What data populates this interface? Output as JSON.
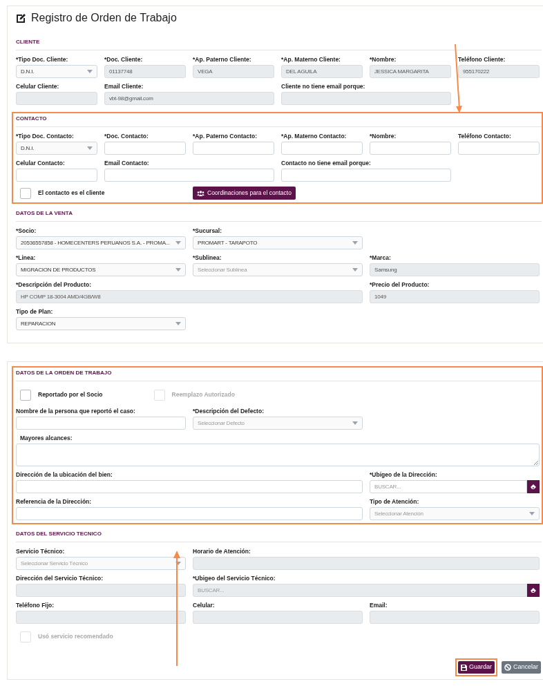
{
  "cards": [
    {
      "title": "Registro de Orden de Trabajo",
      "sections": [
        {
          "title": "CLIENTE",
          "highlighted": false,
          "rows": [
            [
              {
                "kind": "select",
                "label": "*Tipo Doc. Cliente:",
                "value": "D.N.I.",
                "disabled": false
              },
              {
                "kind": "input",
                "label": "*Doc. Cliente:",
                "value": "01137748",
                "disabled": true
              },
              {
                "kind": "input",
                "label": "*Ap. Paterno Cliente:",
                "value": "VEGA",
                "disabled": true
              },
              {
                "kind": "input",
                "label": "*Ap. Materno Cliente:",
                "value": "DEL AGUILA",
                "disabled": true
              },
              {
                "kind": "input",
                "label": "*Nombre:",
                "value": "JESSICA MARGARITA",
                "disabled": true
              },
              {
                "kind": "input",
                "label": "Teléfono Cliente:",
                "value": "955170222",
                "disabled": true
              }
            ],
            [
              {
                "kind": "input",
                "label": "Celular Cliente:",
                "disabled": true
              },
              {
                "kind": "input",
                "label": "Email Cliente:",
                "value": "vbt-98@gmail.com",
                "disabled": true
              },
              "",
              {
                "kind": "input",
                "label": "Cliente no tiene email porque:",
                "disabled": true
              }
            ]
          ]
        },
        {
          "title": "CONTACTO",
          "highlighted": true,
          "rows": [
            [
              {
                "kind": "select",
                "label": "*Tipo Doc. Contacto:",
                "value": "D.N.I.",
                "disabled": false
              },
              {
                "kind": "input",
                "label": "*Doc. Contacto:",
                "disabled": false
              },
              {
                "kind": "input",
                "label": "*Ap. Paterno Contacto:",
                "disabled": false
              },
              {
                "kind": "input",
                "label": "*Ap. Materno Contacto:",
                "disabled": false
              },
              {
                "kind": "input",
                "label": "*Nombre:",
                "disabled": false
              },
              {
                "kind": "input",
                "label": "Teléfono Contacto:",
                "disabled": false
              }
            ],
            [
              {
                "kind": "input",
                "label": "Celular Contacto:",
                "disabled": false
              },
              {
                "kind": "input",
                "label": "Email Contacto:",
                "disabled": false
              },
              "",
              {
                "kind": "input",
                "label": "Contacto no tiene email porque:",
                "disabled": false
              }
            ],
            [
              {
                "kind": "checkbox",
                "label": "El contacto es el cliente",
                "checked": false,
                "disabled": false
              },
              "",
              {
                "kind": "button",
                "label": "Coordinaciones para el contacto"
              }
            ]
          ]
        },
        {
          "title": "DATOS DE LA VENTA",
          "highlighted": false,
          "rows": [
            [
              {
                "kind": "select",
                "label": "*Socio:",
                "value": "20536557858 - HOMECENTERS PERUANOS S.A. - PROMA...",
                "disabled": false
              },
              {
                "kind": "select",
                "label": "*Sucursal:",
                "value": "PROMART - TARAPOTO",
                "disabled": false
              }
            ],
            [
              {
                "kind": "select",
                "label": "*Linea:",
                "value": "MIGRACION DE PRODUCTOS",
                "disabled": false
              },
              {
                "kind": "select",
                "label": "*Sublinea:",
                "placeholder": "Seleccionar Sublínea",
                "disabled": false
              },
              {
                "kind": "input",
                "label": "*Marca:",
                "value": "Samsung",
                "disabled": true
              }
            ],
            [
              {
                "kind": "input",
                "label": "*Descripción del Producto:",
                "value": "HP COMP 18-3004 AMD/4GB/W8",
                "disabled": true
              },
              "",
              {
                "kind": "input",
                "label": "*Precio del Producto:",
                "value": "1049",
                "disabled": true
              }
            ],
            [
              {
                "kind": "select",
                "label": "Tipo de Plan:",
                "value": "REPARACION",
                "disabled": false
              }
            ]
          ]
        }
      ]
    },
    {
      "sections": [
        {
          "title": "DATOS DE LA ORDEN DE TRABAJO",
          "highlighted": true,
          "rows": [
            [
              {
                "kind": "checkbox",
                "label": "Reportado por el Socio",
                "checked": false,
                "disabled": false
              },
              {
                "kind": "checkbox",
                "label": "Reemplazo Autorizado",
                "checked": false,
                "disabled": true
              }
            ],
            [
              {
                "kind": "input",
                "label": "Nombre de la persona que reportó el caso:",
                "disabled": false
              },
              {
                "kind": "select",
                "label": "*Descripción del Defecto:",
                "placeholder": "Seleccionar Defecto",
                "disabled": false
              }
            ],
            [
              {
                "kind": "textarea",
                "label": "Mayores alcances:",
                "disabled": false
              }
            ],
            [
              {
                "kind": "input",
                "label": "Dirección de la ubicación del bien:",
                "disabled": false
              },
              {
                "kind": "search",
                "label": "*Ubigeo de la Dirección:",
                "placeholder": "BUSCAR...",
                "disabled": false
              }
            ],
            [
              {
                "kind": "input",
                "label": "Referencia de la Dirección:",
                "disabled": false
              },
              {
                "kind": "select",
                "label": "Tipo de Atención:",
                "placeholder": "Seleccionar Atención",
                "disabled": false
              }
            ]
          ]
        },
        {
          "title": "DATOS DEL SERVICIO TECNICO",
          "highlighted": false,
          "rows": [
            [
              {
                "kind": "select",
                "label": "Servicio Técnico:",
                "placeholder": "Seleccionar Servicio Técnico",
                "disabled": false
              },
              {
                "kind": "input",
                "label": "Horario de Atención:",
                "disabled": true
              }
            ],
            [
              {
                "kind": "input",
                "label": "Dirección del Servicio Técnico:",
                "disabled": true
              },
              {
                "kind": "search",
                "label": "*Ubigeo del Servicio Técnico:",
                "placeholder": "BUSCAR...",
                "disabled": true
              }
            ],
            [
              {
                "kind": "input",
                "label": "Teléfono Fijo:",
                "disabled": true
              },
              {
                "kind": "input",
                "label": "Celular:",
                "disabled": true
              },
              {
                "kind": "input",
                "label": "Email:",
                "disabled": true
              }
            ],
            [
              {
                "kind": "checkbox",
                "label": "Usó servicio recomendado",
                "checked": false,
                "disabled": true
              }
            ]
          ]
        }
      ],
      "actions": [
        {
          "kind": "save",
          "label": "Guardar",
          "highlighted": true
        },
        {
          "kind": "cancel",
          "label": "Cancelar",
          "highlighted": false
        }
      ]
    }
  ]
}
